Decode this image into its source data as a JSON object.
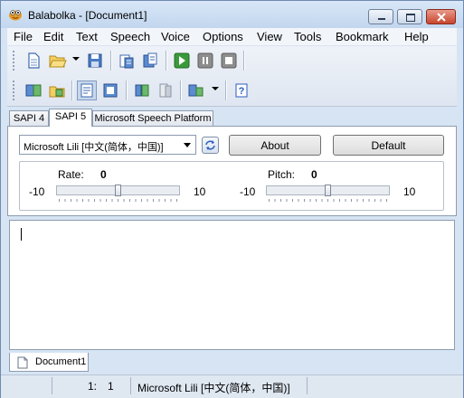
{
  "window": {
    "title": "Balabolka - [Document1]"
  },
  "menu": [
    "File",
    "Edit",
    "Text",
    "Speech",
    "Voice",
    "Options",
    "View",
    "Tools",
    "Bookmark",
    "Help"
  ],
  "toolbar1": [
    "new-document-icon",
    "open-folder-icon",
    "save-icon",
    "read-clipboard-icon",
    "read-selection-icon",
    "play-icon",
    "pause-icon",
    "stop-icon"
  ],
  "toolbar2": [
    "convert-to-audio-icon",
    "open-audio-folder-icon",
    "text-options-icon",
    "dictionary-icon",
    "spell-check-icon",
    "bookmark-icon",
    "voice-settings-icon",
    "help-icon"
  ],
  "tabs": [
    "SAPI 4",
    "SAPI 5",
    "Microsoft Speech Platform"
  ],
  "active_tab": "SAPI 5",
  "voice": {
    "selected": "Microsoft Lili [中文(简体，中国)]",
    "about_label": "About",
    "default_label": "Default"
  },
  "rate": {
    "label": "Rate:",
    "value": "0",
    "min": "-10",
    "max": "10",
    "level": 0.5
  },
  "pitch": {
    "label": "Pitch:",
    "value": "0",
    "min": "-10",
    "max": "10",
    "level": 0.5
  },
  "document_tab": "Document1",
  "status": {
    "line": "1:",
    "col": "1",
    "voice": "Microsoft Lili [中文(简体，中国)]"
  },
  "colors": {
    "play": "#3a9a3a",
    "close_button": "#c7452c",
    "help": "#2a5dbf"
  }
}
